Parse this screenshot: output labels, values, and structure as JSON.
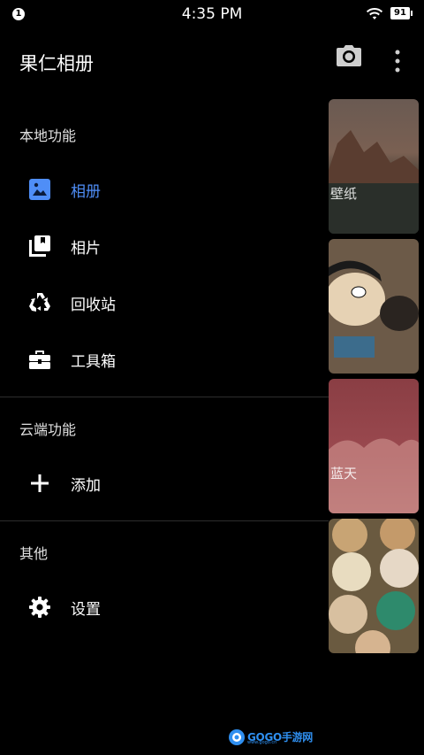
{
  "status_bar": {
    "notification_count": "1",
    "time": "4:35 PM",
    "battery": "91"
  },
  "drawer": {
    "app_title": "果仁相册",
    "sections": [
      {
        "header": "本地功能",
        "items": [
          {
            "label": "相册",
            "icon": "album-icon",
            "active": true
          },
          {
            "label": "相片",
            "icon": "photos-stack-icon",
            "active": false
          },
          {
            "label": "回收站",
            "icon": "recycle-icon",
            "active": false
          },
          {
            "label": "工具箱",
            "icon": "toolbox-icon",
            "active": false
          }
        ]
      },
      {
        "header": "云端功能",
        "items": [
          {
            "label": "添加",
            "icon": "plus-icon",
            "active": false
          }
        ]
      },
      {
        "header": "其他",
        "items": [
          {
            "label": "设置",
            "icon": "gear-icon",
            "active": false
          }
        ]
      }
    ]
  },
  "gallery_behind": {
    "thumb_labels": [
      "壁纸",
      "",
      "蓝天",
      ""
    ]
  },
  "watermark": {
    "text": "GOGO手游网",
    "sub": "www.gogo.cn"
  },
  "colors": {
    "active_accent": "#4f8ef7",
    "background": "#000000",
    "divider": "#2d2d2d"
  }
}
